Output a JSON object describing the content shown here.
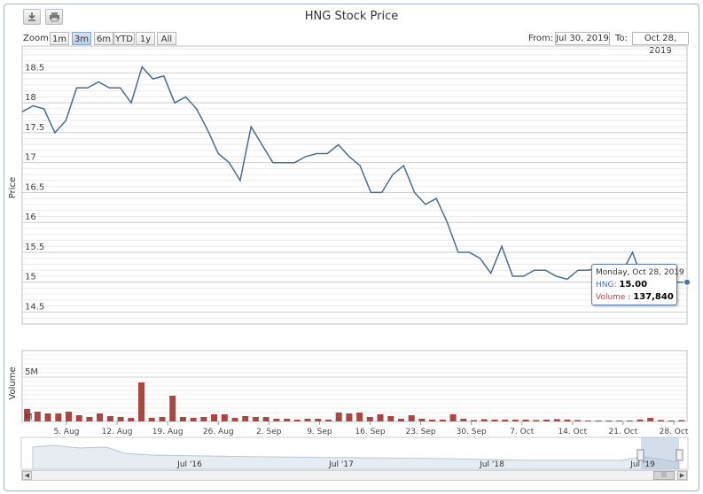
{
  "title": "HNG Stock Price",
  "toolbar": {
    "download_icon": "download-icon",
    "print_icon": "print-icon"
  },
  "zoom": {
    "label": "Zoom",
    "buttons": [
      "1m",
      "3m",
      "6m",
      "YTD",
      "1y",
      "All"
    ],
    "active": "3m"
  },
  "range": {
    "from_label": "From:",
    "from_value": "Jul 30, 2019",
    "to_label": "To:",
    "to_value": "Oct 28, 2019"
  },
  "tooltip": {
    "date": "Monday, Oct 28, 2019",
    "series_label": "HNG",
    "series_value": "15.00",
    "volume_label": "Volume",
    "volume_value": "137,840"
  },
  "navigator": {
    "labels": [
      "Jul '16",
      "Jul '17",
      "Jul '18",
      "Jul '19"
    ]
  },
  "colors": {
    "price_line": "#4a6d8c",
    "volume_bar": "#aa4643",
    "grid": "#d8d8d8",
    "accent": "#4572a7"
  },
  "chart_data": {
    "type": "line",
    "title": "HNG Stock Price",
    "price": {
      "ylabel": "Price",
      "ylim": [
        14.3,
        18.95
      ],
      "yticks": [
        14.5,
        15,
        15.5,
        16,
        16.5,
        17,
        17.5,
        18,
        18.5
      ],
      "ytick_labels": [
        "14.5",
        "15",
        "15.5",
        "16",
        "16.5",
        "17",
        "17.5",
        "18",
        "18.5"
      ],
      "values": [
        17.85,
        17.95,
        17.9,
        17.5,
        17.7,
        18.25,
        18.25,
        18.35,
        18.25,
        18.25,
        18.0,
        18.6,
        18.4,
        18.45,
        18.0,
        18.1,
        17.9,
        17.55,
        17.15,
        17.0,
        16.7,
        17.6,
        17.3,
        17.0,
        17.0,
        17.0,
        17.1,
        17.15,
        17.15,
        17.3,
        17.1,
        16.95,
        16.5,
        16.5,
        16.8,
        16.95,
        16.5,
        16.3,
        16.4,
        16.0,
        15.5,
        15.5,
        15.4,
        15.15,
        15.6,
        15.1,
        15.1,
        15.2,
        15.2,
        15.1,
        15.05,
        15.2,
        15.2,
        15.25,
        15.2,
        15.15,
        15.5,
        15.0,
        15.0,
        15.0,
        15.0,
        15.0
      ]
    },
    "volume": {
      "ylabel": "Volume",
      "ylim": [
        0,
        8
      ],
      "ytick_labels": [
        "M",
        "5M"
      ],
      "values_millions": [
        1.4,
        1.1,
        0.9,
        0.9,
        1.1,
        0.7,
        0.5,
        0.9,
        0.6,
        0.5,
        0.4,
        4.4,
        0.4,
        0.5,
        2.9,
        0.5,
        0.4,
        0.5,
        0.8,
        0.8,
        0.4,
        0.6,
        0.5,
        0.5,
        0.3,
        0.3,
        0.2,
        0.3,
        0.3,
        0.2,
        1.0,
        0.9,
        1.0,
        0.5,
        0.8,
        0.6,
        0.3,
        0.7,
        0.3,
        0.2,
        0.2,
        0.8,
        0.3,
        0.15,
        0.25,
        0.2,
        0.2,
        0.2,
        0.2,
        0.15,
        0.2,
        0.25,
        0.2,
        0.15,
        0.1,
        0.1,
        0.1,
        0.1,
        0.1,
        0.2,
        0.4,
        0.15,
        0.1,
        0.15
      ]
    },
    "xtick_labels": [
      "5. Aug",
      "12. Aug",
      "19. Aug",
      "26. Aug",
      "2. Sep",
      "9. Sep",
      "16. Sep",
      "23. Sep",
      "30. Sep",
      "7. Oct",
      "14. Oct",
      "21. Oct",
      "28. Oct"
    ],
    "grid": true,
    "legend": "none"
  }
}
